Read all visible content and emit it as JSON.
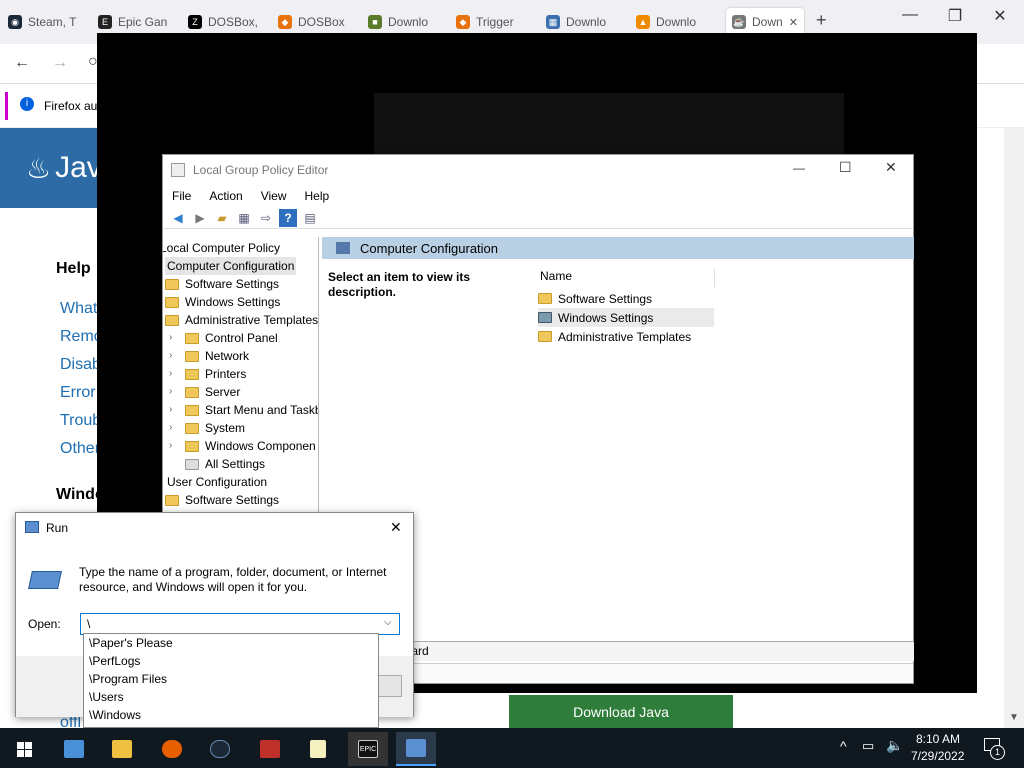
{
  "browser": {
    "tabs": [
      {
        "label": "Steam, T",
        "color": "#1b2838",
        "glyph": "◉"
      },
      {
        "label": "Epic Gan",
        "color": "#222",
        "glyph": "E"
      },
      {
        "label": "DOSBox,",
        "color": "#000",
        "glyph": "Z"
      },
      {
        "label": "DOSBox",
        "color": "#e8720c",
        "glyph": "◆"
      },
      {
        "label": "Downlo",
        "color": "#5b7a2a",
        "glyph": "■"
      },
      {
        "label": "Trigger",
        "color": "#e8720c",
        "glyph": "◆"
      },
      {
        "label": "Downlo",
        "color": "#3c6fb0",
        "glyph": "▦"
      },
      {
        "label": "Downlo",
        "color": "#f08a00",
        "glyph": "▲"
      },
      {
        "label": "Down",
        "color": "#777",
        "glyph": "☕"
      }
    ],
    "new_tab": "+",
    "notification": "Firefox aut",
    "page": {
      "brand": "Jav",
      "heading": "Help",
      "links": [
        "What",
        "Remo",
        "Disab",
        "Error",
        "Troub",
        "Other"
      ],
      "section": "Windo",
      "footer_link": "offl",
      "download_button": "Download Java"
    }
  },
  "gpedit": {
    "title": "Local Group Policy Editor",
    "menu": [
      "File",
      "Action",
      "View",
      "Help"
    ],
    "tree": {
      "root": "Local Computer Policy",
      "computer_config": "Computer Configuration",
      "software_settings": "Software Settings",
      "windows_settings": "Windows Settings",
      "admin_templates": "Administrative Templates",
      "admin_children": [
        "Control Panel",
        "Network",
        "Printers",
        "Server",
        "Start Menu and Taskb",
        "System",
        "Windows Componen",
        "All Settings"
      ],
      "user_config": "User Configuration",
      "user_software": "Software Settings"
    },
    "right": {
      "header": "Computer Configuration",
      "description": "Select an item to view its description.",
      "column": "Name",
      "items": [
        "Software Settings",
        "Windows Settings",
        "Administrative Templates"
      ],
      "tab_partial": "ndard"
    }
  },
  "run": {
    "title": "Run",
    "description": "Type the name of a program, folder, document, or Internet resource, and Windows will open it for you.",
    "open_label": "Open:",
    "input_value": "\\",
    "suggestions": [
      "\\Paper's Please",
      "\\PerfLogs",
      "\\Program Files",
      "\\Users",
      "\\Windows"
    ]
  },
  "taskbar": {
    "time": "8:10 AM",
    "date": "7/29/2022",
    "notification_count": "1"
  },
  "colors": {
    "accent": "#0078d7",
    "java_blue": "#2c6ba5",
    "download_green": "#2e7d3a",
    "taskbar": "#101820"
  }
}
